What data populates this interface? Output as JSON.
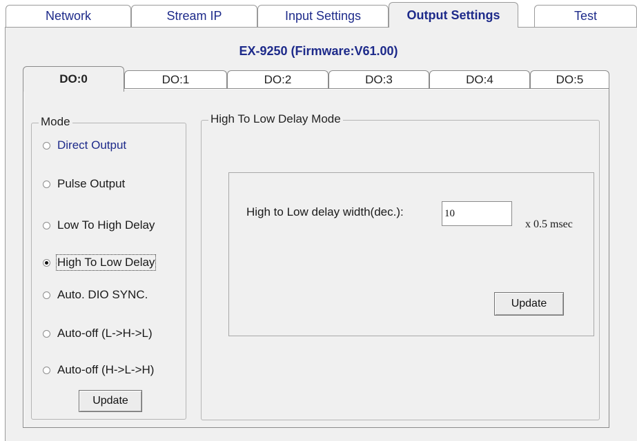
{
  "top_tabs": [
    {
      "label": "Network"
    },
    {
      "label": "Stream IP"
    },
    {
      "label": "Input Settings"
    },
    {
      "label": "Output Settings",
      "active": true
    },
    {
      "label": "Test"
    }
  ],
  "device_title": "EX-9250 (Firmware:V61.00)",
  "do_tabs": [
    {
      "label": "DO:0",
      "active": true
    },
    {
      "label": "DO:1"
    },
    {
      "label": "DO:2"
    },
    {
      "label": "DO:3"
    },
    {
      "label": "DO:4"
    },
    {
      "label": "DO:5"
    }
  ],
  "mode": {
    "legend": "Mode",
    "options": [
      {
        "label": "Direct Output",
        "checked": false
      },
      {
        "label": "Pulse Output",
        "checked": false
      },
      {
        "label": "Low To High Delay",
        "checked": false
      },
      {
        "label": "High To Low Delay",
        "checked": true
      },
      {
        "label": "Auto. DIO SYNC.",
        "checked": false
      },
      {
        "label": "Auto-off (L->H->L)",
        "checked": false
      },
      {
        "label": "Auto-off (H->L->H)",
        "checked": false
      }
    ],
    "update_label": "Update"
  },
  "detail": {
    "legend": "High To Low Delay Mode",
    "field_label": "High to Low delay width(dec.):",
    "field_value": "10",
    "unit": "x 0.5 msec",
    "update_label": "Update"
  }
}
